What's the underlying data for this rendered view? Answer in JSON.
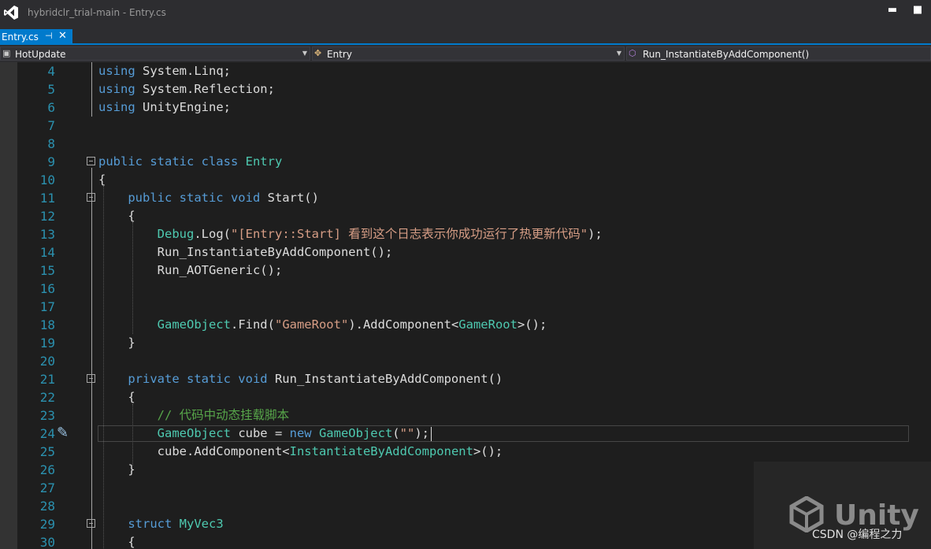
{
  "window": {
    "title": "hybridclr_trial-main - Entry.cs",
    "minimize_glyph": "▬",
    "maximize_glyph": "■"
  },
  "tab": {
    "label": "Entry.cs",
    "pin_glyph": "⊣",
    "close_glyph": "✕"
  },
  "navbar": {
    "project": {
      "label": "HotUpdate",
      "icon": "csharp-project-icon"
    },
    "type": {
      "label": "Entry",
      "icon": "class-icon"
    },
    "member": {
      "label": "Run_InstantiateByAddComponent()",
      "icon": "method-icon"
    }
  },
  "editor": {
    "current_line": 24,
    "lines": [
      {
        "n": "4",
        "tokens": [
          [
            "kw",
            "using"
          ],
          [
            "pl",
            " System.Linq;"
          ]
        ]
      },
      {
        "n": "5",
        "tokens": [
          [
            "kw",
            "using"
          ],
          [
            "pl",
            " System.Reflection;"
          ]
        ]
      },
      {
        "n": "6",
        "tokens": [
          [
            "kw",
            "using"
          ],
          [
            "pl",
            " UnityEngine;"
          ]
        ]
      },
      {
        "n": "7",
        "tokens": []
      },
      {
        "n": "8",
        "tokens": []
      },
      {
        "n": "9",
        "tokens": [
          [
            "kw",
            "public static class "
          ],
          [
            "ty",
            "Entry"
          ]
        ]
      },
      {
        "n": "10",
        "tokens": [
          [
            "pl",
            "{"
          ]
        ]
      },
      {
        "n": "11",
        "tokens": [
          [
            "pl",
            "    "
          ],
          [
            "kw",
            "public static void "
          ],
          [
            "pl",
            "Start()"
          ]
        ]
      },
      {
        "n": "12",
        "tokens": [
          [
            "pl",
            "    {"
          ]
        ]
      },
      {
        "n": "13",
        "tokens": [
          [
            "pl",
            "        "
          ],
          [
            "ty",
            "Debug"
          ],
          [
            "pl",
            ".Log("
          ],
          [
            "str",
            "\"[Entry::Start] 看到这个日志表示你成功运行了热更新代码\""
          ],
          [
            "pl",
            ");"
          ]
        ]
      },
      {
        "n": "14",
        "tokens": [
          [
            "pl",
            "        Run_InstantiateByAddComponent();"
          ]
        ]
      },
      {
        "n": "15",
        "tokens": [
          [
            "pl",
            "        Run_AOTGeneric();"
          ]
        ]
      },
      {
        "n": "16",
        "tokens": []
      },
      {
        "n": "17",
        "tokens": []
      },
      {
        "n": "18",
        "tokens": [
          [
            "pl",
            "        "
          ],
          [
            "ty",
            "GameObject"
          ],
          [
            "pl",
            ".Find("
          ],
          [
            "str",
            "\"GameRoot\""
          ],
          [
            "pl",
            ").AddComponent<"
          ],
          [
            "ty",
            "GameRoot"
          ],
          [
            "pl",
            ">();"
          ]
        ]
      },
      {
        "n": "19",
        "tokens": [
          [
            "pl",
            "    }"
          ]
        ]
      },
      {
        "n": "20",
        "tokens": []
      },
      {
        "n": "21",
        "tokens": [
          [
            "pl",
            "    "
          ],
          [
            "kw",
            "private static void "
          ],
          [
            "pl",
            "Run_InstantiateByAddComponent()"
          ]
        ]
      },
      {
        "n": "22",
        "tokens": [
          [
            "pl",
            "    {"
          ]
        ]
      },
      {
        "n": "23",
        "tokens": [
          [
            "pl",
            "        "
          ],
          [
            "cm",
            "// 代码中动态挂载脚本"
          ]
        ]
      },
      {
        "n": "24",
        "tokens": [
          [
            "pl",
            "        "
          ],
          [
            "ty",
            "GameObject"
          ],
          [
            "pl",
            " cube = "
          ],
          [
            "kw",
            "new "
          ],
          [
            "ty",
            "GameObject"
          ],
          [
            "pl",
            "("
          ],
          [
            "str",
            "\"\""
          ],
          [
            "pl",
            ");"
          ]
        ]
      },
      {
        "n": "25",
        "tokens": [
          [
            "pl",
            "        cube.AddComponent<"
          ],
          [
            "ty",
            "InstantiateByAddComponent"
          ],
          [
            "pl",
            ">();"
          ]
        ]
      },
      {
        "n": "26",
        "tokens": [
          [
            "pl",
            "    }"
          ]
        ]
      },
      {
        "n": "27",
        "tokens": []
      },
      {
        "n": "28",
        "tokens": []
      },
      {
        "n": "29",
        "tokens": [
          [
            "pl",
            "    "
          ],
          [
            "kw",
            "struct "
          ],
          [
            "ty",
            "MyVec3"
          ]
        ]
      },
      {
        "n": "30",
        "tokens": [
          [
            "pl",
            "    {"
          ]
        ]
      }
    ]
  },
  "watermark": {
    "brand": "Unity",
    "credit": "CSDN @编程之力"
  },
  "colors": {
    "keyword": "#569cd6",
    "type": "#4ec9b0",
    "string": "#d69d85",
    "comment": "#57a64a",
    "line_number": "#2b91af",
    "accent": "#007acc"
  }
}
